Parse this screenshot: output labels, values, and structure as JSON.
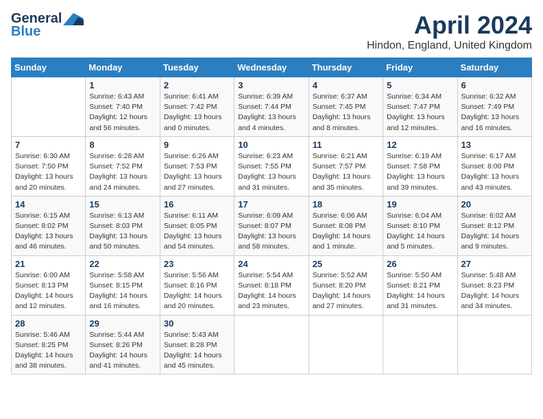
{
  "app": {
    "logo_general": "General",
    "logo_blue": "Blue",
    "month_title": "April 2024",
    "location": "Hindon, England, United Kingdom"
  },
  "calendar": {
    "days_of_week": [
      "Sunday",
      "Monday",
      "Tuesday",
      "Wednesday",
      "Thursday",
      "Friday",
      "Saturday"
    ],
    "weeks": [
      [
        {
          "day": "",
          "info": ""
        },
        {
          "day": "1",
          "info": "Sunrise: 6:43 AM\nSunset: 7:40 PM\nDaylight: 12 hours\nand 56 minutes."
        },
        {
          "day": "2",
          "info": "Sunrise: 6:41 AM\nSunset: 7:42 PM\nDaylight: 13 hours\nand 0 minutes."
        },
        {
          "day": "3",
          "info": "Sunrise: 6:39 AM\nSunset: 7:44 PM\nDaylight: 13 hours\nand 4 minutes."
        },
        {
          "day": "4",
          "info": "Sunrise: 6:37 AM\nSunset: 7:45 PM\nDaylight: 13 hours\nand 8 minutes."
        },
        {
          "day": "5",
          "info": "Sunrise: 6:34 AM\nSunset: 7:47 PM\nDaylight: 13 hours\nand 12 minutes."
        },
        {
          "day": "6",
          "info": "Sunrise: 6:32 AM\nSunset: 7:49 PM\nDaylight: 13 hours\nand 16 minutes."
        }
      ],
      [
        {
          "day": "7",
          "info": "Sunrise: 6:30 AM\nSunset: 7:50 PM\nDaylight: 13 hours\nand 20 minutes."
        },
        {
          "day": "8",
          "info": "Sunrise: 6:28 AM\nSunset: 7:52 PM\nDaylight: 13 hours\nand 24 minutes."
        },
        {
          "day": "9",
          "info": "Sunrise: 6:26 AM\nSunset: 7:53 PM\nDaylight: 13 hours\nand 27 minutes."
        },
        {
          "day": "10",
          "info": "Sunrise: 6:23 AM\nSunset: 7:55 PM\nDaylight: 13 hours\nand 31 minutes."
        },
        {
          "day": "11",
          "info": "Sunrise: 6:21 AM\nSunset: 7:57 PM\nDaylight: 13 hours\nand 35 minutes."
        },
        {
          "day": "12",
          "info": "Sunrise: 6:19 AM\nSunset: 7:58 PM\nDaylight: 13 hours\nand 39 minutes."
        },
        {
          "day": "13",
          "info": "Sunrise: 6:17 AM\nSunset: 8:00 PM\nDaylight: 13 hours\nand 43 minutes."
        }
      ],
      [
        {
          "day": "14",
          "info": "Sunrise: 6:15 AM\nSunset: 8:02 PM\nDaylight: 13 hours\nand 46 minutes."
        },
        {
          "day": "15",
          "info": "Sunrise: 6:13 AM\nSunset: 8:03 PM\nDaylight: 13 hours\nand 50 minutes."
        },
        {
          "day": "16",
          "info": "Sunrise: 6:11 AM\nSunset: 8:05 PM\nDaylight: 13 hours\nand 54 minutes."
        },
        {
          "day": "17",
          "info": "Sunrise: 6:09 AM\nSunset: 8:07 PM\nDaylight: 13 hours\nand 58 minutes."
        },
        {
          "day": "18",
          "info": "Sunrise: 6:06 AM\nSunset: 8:08 PM\nDaylight: 14 hours\nand 1 minute."
        },
        {
          "day": "19",
          "info": "Sunrise: 6:04 AM\nSunset: 8:10 PM\nDaylight: 14 hours\nand 5 minutes."
        },
        {
          "day": "20",
          "info": "Sunrise: 6:02 AM\nSunset: 8:12 PM\nDaylight: 14 hours\nand 9 minutes."
        }
      ],
      [
        {
          "day": "21",
          "info": "Sunrise: 6:00 AM\nSunset: 8:13 PM\nDaylight: 14 hours\nand 12 minutes."
        },
        {
          "day": "22",
          "info": "Sunrise: 5:58 AM\nSunset: 8:15 PM\nDaylight: 14 hours\nand 16 minutes."
        },
        {
          "day": "23",
          "info": "Sunrise: 5:56 AM\nSunset: 8:16 PM\nDaylight: 14 hours\nand 20 minutes."
        },
        {
          "day": "24",
          "info": "Sunrise: 5:54 AM\nSunset: 8:18 PM\nDaylight: 14 hours\nand 23 minutes."
        },
        {
          "day": "25",
          "info": "Sunrise: 5:52 AM\nSunset: 8:20 PM\nDaylight: 14 hours\nand 27 minutes."
        },
        {
          "day": "26",
          "info": "Sunrise: 5:50 AM\nSunset: 8:21 PM\nDaylight: 14 hours\nand 31 minutes."
        },
        {
          "day": "27",
          "info": "Sunrise: 5:48 AM\nSunset: 8:23 PM\nDaylight: 14 hours\nand 34 minutes."
        }
      ],
      [
        {
          "day": "28",
          "info": "Sunrise: 5:46 AM\nSunset: 8:25 PM\nDaylight: 14 hours\nand 38 minutes."
        },
        {
          "day": "29",
          "info": "Sunrise: 5:44 AM\nSunset: 8:26 PM\nDaylight: 14 hours\nand 41 minutes."
        },
        {
          "day": "30",
          "info": "Sunrise: 5:43 AM\nSunset: 8:28 PM\nDaylight: 14 hours\nand 45 minutes."
        },
        {
          "day": "",
          "info": ""
        },
        {
          "day": "",
          "info": ""
        },
        {
          "day": "",
          "info": ""
        },
        {
          "day": "",
          "info": ""
        }
      ]
    ]
  }
}
